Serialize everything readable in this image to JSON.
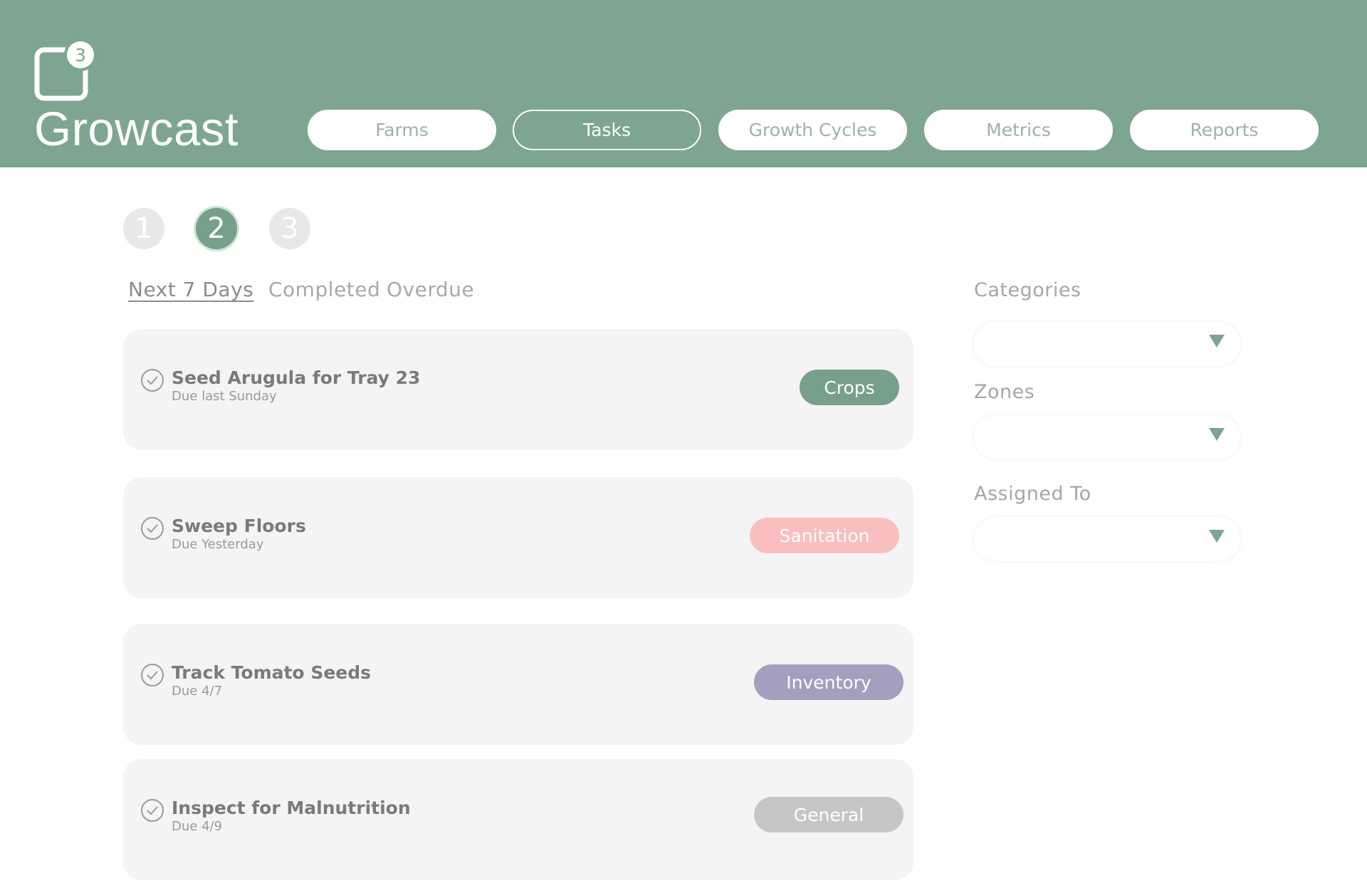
{
  "app": {
    "title": "Growcast",
    "notification_count": "3"
  },
  "nav": [
    {
      "label": "Farms"
    },
    {
      "label": "Tasks"
    },
    {
      "label": "Growth Cycles"
    },
    {
      "label": "Metrics"
    },
    {
      "label": "Reports"
    }
  ],
  "steps": [
    "1",
    "2",
    "3"
  ],
  "tabs": [
    {
      "label": "Next 7 Days"
    },
    {
      "label": "Completed"
    },
    {
      "label": "Overdue"
    }
  ],
  "tasks": [
    {
      "title": "Seed Arugula for Tray 23",
      "due": "Due last Sunday",
      "category": "Crops",
      "color": "#77a08a"
    },
    {
      "title": "Sweep Floors",
      "due": "Due Yesterday",
      "category": "Sanitation",
      "color": "#f9bfbf"
    },
    {
      "title": "Track Tomato Seeds",
      "due": "Due 4/7",
      "category": "Inventory",
      "color": "#a29fbf"
    },
    {
      "title": "Inspect for Malnutrition",
      "due": "Due 4/9",
      "category": "General",
      "color": "#c6c6c6"
    }
  ],
  "filters": [
    {
      "label": "Categories"
    },
    {
      "label": "Zones"
    },
    {
      "label": "Assigned To"
    }
  ],
  "colors": {
    "brand": "#7ea58f",
    "card": "#f4f4f4"
  }
}
